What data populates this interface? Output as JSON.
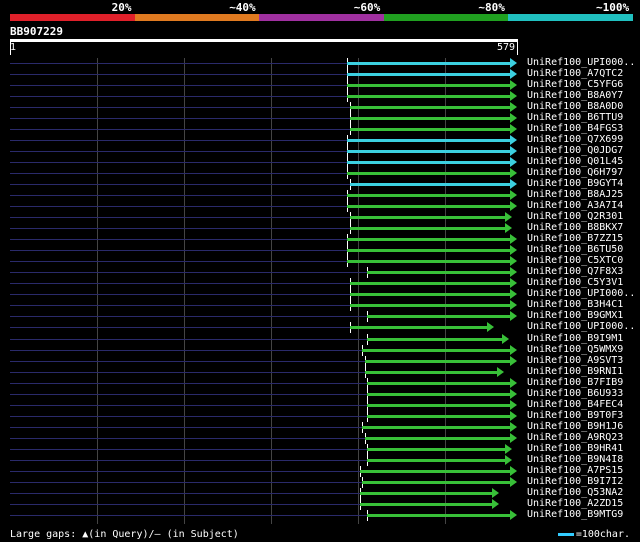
{
  "legend": {
    "labels": [
      "20%",
      "~40%",
      "~60%",
      "~80%",
      "~100%"
    ],
    "colors": [
      "#e0202a",
      "#e07a20",
      "#a030a0",
      "#20a020",
      "#20c0c0"
    ]
  },
  "query": {
    "id": "BB907229",
    "start": "1",
    "end": "579"
  },
  "hits": [
    {
      "name": "UniRef100_UPI000..",
      "start": 0.665,
      "end": 1.0,
      "color": "#3cd0e0"
    },
    {
      "name": "UniRef100_A7QTC2",
      "start": 0.665,
      "end": 1.0,
      "color": "#3cd0e0"
    },
    {
      "name": "UniRef100_C5YFG6",
      "start": 0.665,
      "end": 1.0,
      "color": "#38c038"
    },
    {
      "name": "UniRef100_B8A0Y7",
      "start": 0.665,
      "end": 1.0,
      "color": "#38c038"
    },
    {
      "name": "UniRef100_B8A0D0",
      "start": 0.67,
      "end": 1.0,
      "color": "#38c038"
    },
    {
      "name": "UniRef100_B6TTU9",
      "start": 0.67,
      "end": 1.0,
      "color": "#38c038"
    },
    {
      "name": "UniRef100_B4FGS3",
      "start": 0.67,
      "end": 1.0,
      "color": "#38c038"
    },
    {
      "name": "UniRef100_Q7X699",
      "start": 0.665,
      "end": 1.0,
      "color": "#3cd0e0"
    },
    {
      "name": "UniRef100_Q0JDG7",
      "start": 0.665,
      "end": 1.0,
      "color": "#3cd0e0"
    },
    {
      "name": "UniRef100_Q01L45",
      "start": 0.665,
      "end": 1.0,
      "color": "#3cd0e0"
    },
    {
      "name": "UniRef100_Q6H797",
      "start": 0.665,
      "end": 1.0,
      "color": "#38c038"
    },
    {
      "name": "UniRef100_B9GYT4",
      "start": 0.67,
      "end": 1.0,
      "color": "#3cd0e0"
    },
    {
      "name": "UniRef100_B8AJ25",
      "start": 0.665,
      "end": 1.0,
      "color": "#38c038"
    },
    {
      "name": "UniRef100_A3A7I4",
      "start": 0.665,
      "end": 1.0,
      "color": "#38c038"
    },
    {
      "name": "UniRef100_Q2R301",
      "start": 0.67,
      "end": 0.99,
      "color": "#38c038"
    },
    {
      "name": "UniRef100_B8BKX7",
      "start": 0.67,
      "end": 0.99,
      "color": "#38c038"
    },
    {
      "name": "UniRef100_B7ZZ15",
      "start": 0.665,
      "end": 1.0,
      "color": "#38c038"
    },
    {
      "name": "UniRef100_B6TU50",
      "start": 0.665,
      "end": 1.0,
      "color": "#38c038"
    },
    {
      "name": "UniRef100_C5XTC0",
      "start": 0.665,
      "end": 1.0,
      "color": "#38c038"
    },
    {
      "name": "UniRef100_Q7F8X3",
      "start": 0.705,
      "end": 1.0,
      "color": "#38c038"
    },
    {
      "name": "UniRef100_C5Y3V1",
      "start": 0.67,
      "end": 1.0,
      "color": "#38c038"
    },
    {
      "name": "UniRef100_UPI000..",
      "start": 0.67,
      "end": 1.0,
      "color": "#38c038"
    },
    {
      "name": "UniRef100_B3H4C1",
      "start": 0.67,
      "end": 1.0,
      "color": "#38c038"
    },
    {
      "name": "UniRef100_B9GMX1",
      "start": 0.705,
      "end": 1.0,
      "color": "#38c038"
    },
    {
      "name": "UniRef100_UPI000..",
      "start": 0.67,
      "end": 0.955,
      "color": "#38c038"
    },
    {
      "name": "UniRef100_B9I9M1",
      "start": 0.705,
      "end": 0.985,
      "color": "#38c038"
    },
    {
      "name": "UniRef100_Q5WMX9",
      "start": 0.695,
      "end": 1.0,
      "color": "#38c038"
    },
    {
      "name": "UniRef100_A9SVT3",
      "start": 0.7,
      "end": 1.0,
      "color": "#38c038"
    },
    {
      "name": "UniRef100_B9RNI1",
      "start": 0.7,
      "end": 0.975,
      "color": "#38c038"
    },
    {
      "name": "UniRef100_B7FIB9",
      "start": 0.705,
      "end": 1.0,
      "color": "#38c038"
    },
    {
      "name": "UniRef100_B6U933",
      "start": 0.705,
      "end": 1.0,
      "color": "#38c038"
    },
    {
      "name": "UniRef100_B4FEC4",
      "start": 0.705,
      "end": 1.0,
      "color": "#38c038"
    },
    {
      "name": "UniRef100_B9T0F3",
      "start": 0.705,
      "end": 1.0,
      "color": "#38c038"
    },
    {
      "name": "UniRef100_B9H1J6",
      "start": 0.695,
      "end": 1.0,
      "color": "#38c038"
    },
    {
      "name": "UniRef100_A9RQ23",
      "start": 0.7,
      "end": 1.0,
      "color": "#38c038"
    },
    {
      "name": "UniRef100_B9HR41",
      "start": 0.705,
      "end": 0.99,
      "color": "#38c038"
    },
    {
      "name": "UniRef100_B9N4I8",
      "start": 0.705,
      "end": 0.99,
      "color": "#38c038"
    },
    {
      "name": "UniRef100_A7PS15",
      "start": 0.69,
      "end": 1.0,
      "color": "#38c038"
    },
    {
      "name": "UniRef100_B9I7I2",
      "start": 0.695,
      "end": 1.0,
      "color": "#38c038"
    },
    {
      "name": "UniRef100_Q53NA2",
      "start": 0.69,
      "end": 0.965,
      "color": "#38c038"
    },
    {
      "name": "UniRef100_A2ZD15",
      "start": 0.69,
      "end": 0.965,
      "color": "#38c038"
    },
    {
      "name": "UniRef100_B9MTG9",
      "start": 0.705,
      "end": 1.0,
      "color": "#38c038"
    }
  ],
  "footer": {
    "left_prefix": "Large gaps: ",
    "left_query_icon": "▲",
    "left_query": "(in Query)/",
    "left_subject_icon": "—",
    "left_subject": " (in Subject)",
    "right_label": "=100char."
  }
}
